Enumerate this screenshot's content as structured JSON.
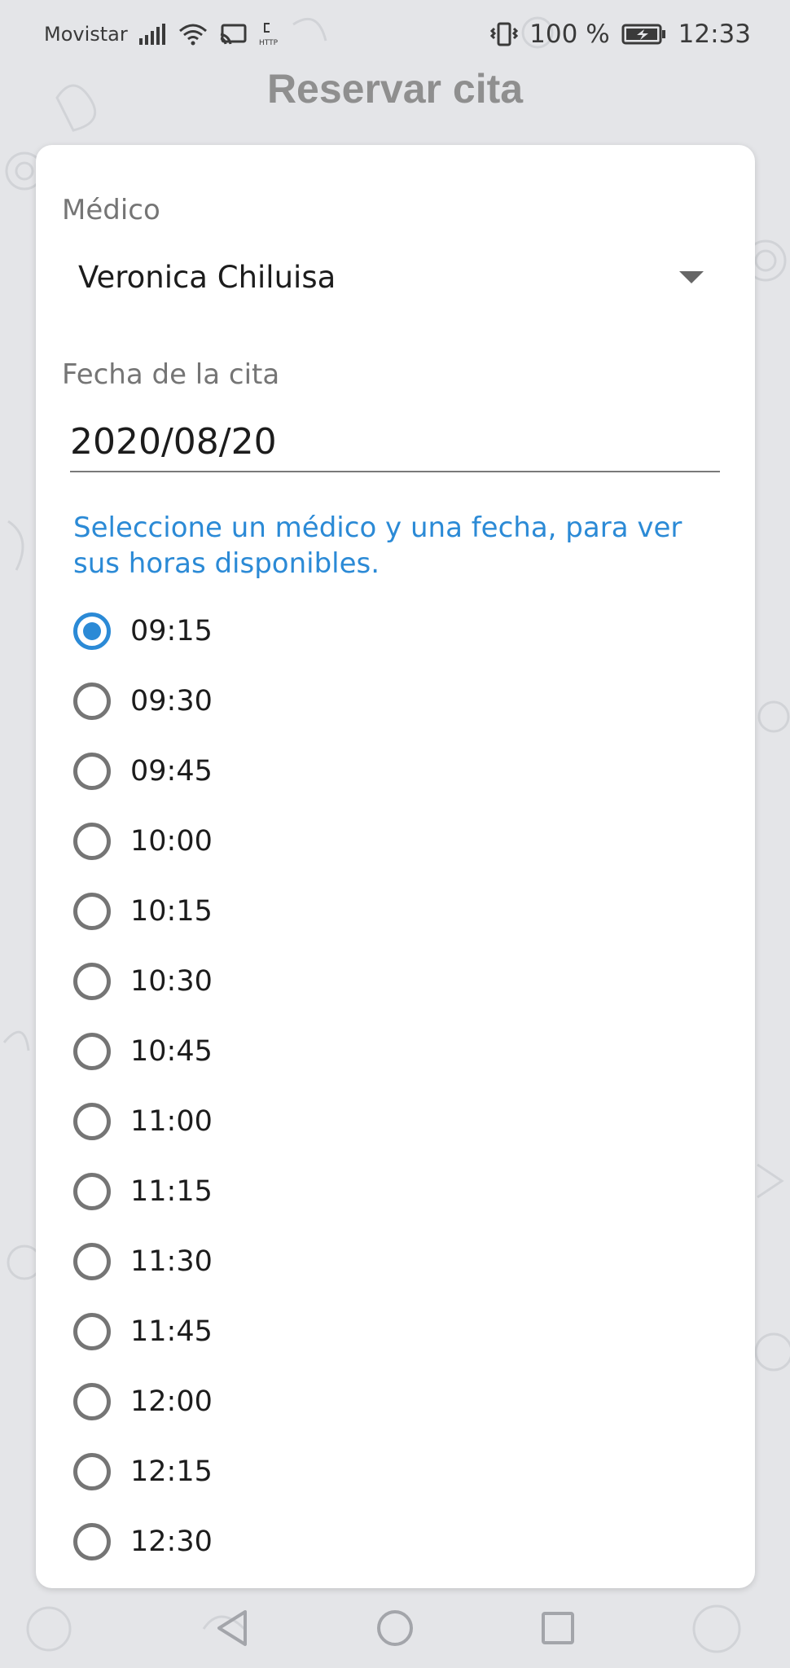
{
  "status_bar": {
    "carrier": "Movistar",
    "battery_percent": "100 %",
    "time": "12:33",
    "icons": [
      "signal-icon",
      "wifi-icon",
      "cast-icon",
      "http-icon",
      "vibrate-icon",
      "battery-charging-icon"
    ]
  },
  "header": {
    "title": "Reservar cita"
  },
  "form": {
    "doctor_label": "Médico",
    "doctor_value": "Veronica Chiluisa",
    "date_label": "Fecha de la cita",
    "date_value": "2020/08/20",
    "hint": "Seleccione un médico y una fecha, para ver sus horas disponibles."
  },
  "times": [
    {
      "label": "09:15",
      "selected": true
    },
    {
      "label": "09:30",
      "selected": false
    },
    {
      "label": "09:45",
      "selected": false
    },
    {
      "label": "10:00",
      "selected": false
    },
    {
      "label": "10:15",
      "selected": false
    },
    {
      "label": "10:30",
      "selected": false
    },
    {
      "label": "10:45",
      "selected": false
    },
    {
      "label": "11:00",
      "selected": false
    },
    {
      "label": "11:15",
      "selected": false
    },
    {
      "label": "11:30",
      "selected": false
    },
    {
      "label": "11:45",
      "selected": false
    },
    {
      "label": "12:00",
      "selected": false
    },
    {
      "label": "12:15",
      "selected": false
    },
    {
      "label": "12:30",
      "selected": false
    }
  ],
  "nav": {
    "icons": [
      "back-icon",
      "home-icon",
      "recents-icon"
    ]
  },
  "colors": {
    "accent": "#2b8ad6",
    "title": "#8f8f8f",
    "background": "#e4e5e8"
  }
}
